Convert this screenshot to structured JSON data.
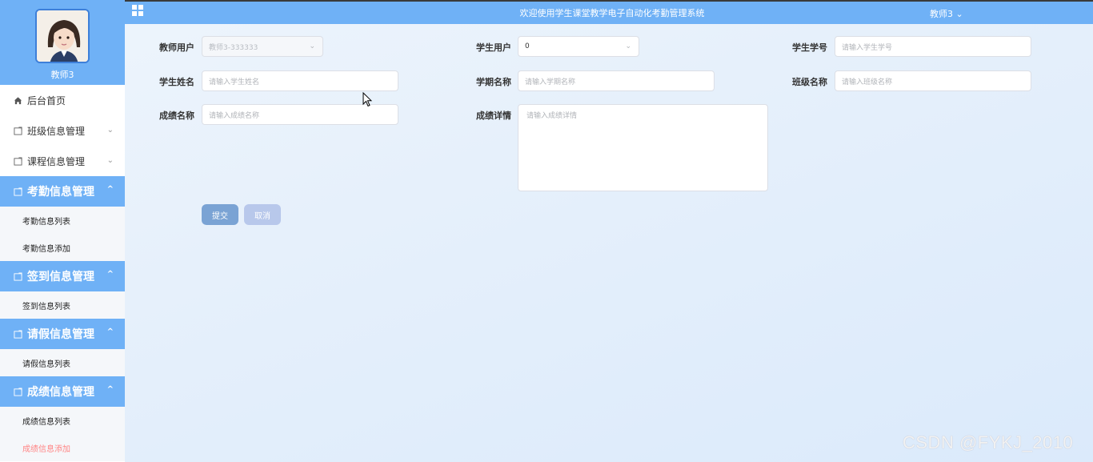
{
  "header": {
    "title": "欢迎使用学生课堂教学电子自动化考勤管理系统",
    "user_menu": "教师3",
    "user_menu_chevron": "⌄",
    "menu_icon": "grid-icon"
  },
  "sidebar": {
    "profile_name": "教师3",
    "home": "后台首页",
    "items": [
      {
        "label": "班级信息管理",
        "icon": "folder-icon"
      },
      {
        "label": "课程信息管理",
        "icon": "folder-icon"
      }
    ],
    "groups": [
      {
        "label": "考勤信息管理",
        "subs": [
          "考勤信息列表",
          "考勤信息添加"
        ]
      },
      {
        "label": "签到信息管理",
        "subs": [
          "签到信息列表"
        ]
      },
      {
        "label": "请假信息管理",
        "subs": [
          "请假信息列表"
        ]
      },
      {
        "label": "成绩信息管理",
        "subs": [
          "成绩信息列表",
          "成绩信息添加"
        ]
      }
    ],
    "active_sub": "成绩信息添加"
  },
  "form": {
    "teacher_user": {
      "label": "教师用户",
      "value": "教师3-333333"
    },
    "student_user": {
      "label": "学生用户",
      "value": "0"
    },
    "student_no": {
      "label": "学生学号",
      "placeholder": "请输入学生学号"
    },
    "student_name": {
      "label": "学生姓名",
      "placeholder": "请输入学生姓名"
    },
    "term_name": {
      "label": "学期名称",
      "placeholder": "请输入学期名称"
    },
    "class_name": {
      "label": "班级名称",
      "placeholder": "请输入班级名称"
    },
    "grade_name": {
      "label": "成绩名称",
      "placeholder": "请输入成绩名称"
    },
    "grade_detail": {
      "label": "成绩详情",
      "placeholder": "请输入成绩详情"
    },
    "submit": "提交",
    "cancel": "取消"
  },
  "colors": {
    "primary": "#6fb1f6",
    "submit_button": "#7aa3d4",
    "cancel_button": "#b8c8eb",
    "active_sub": "#ff8585"
  },
  "watermark": "CSDN @FYKJ_2010"
}
